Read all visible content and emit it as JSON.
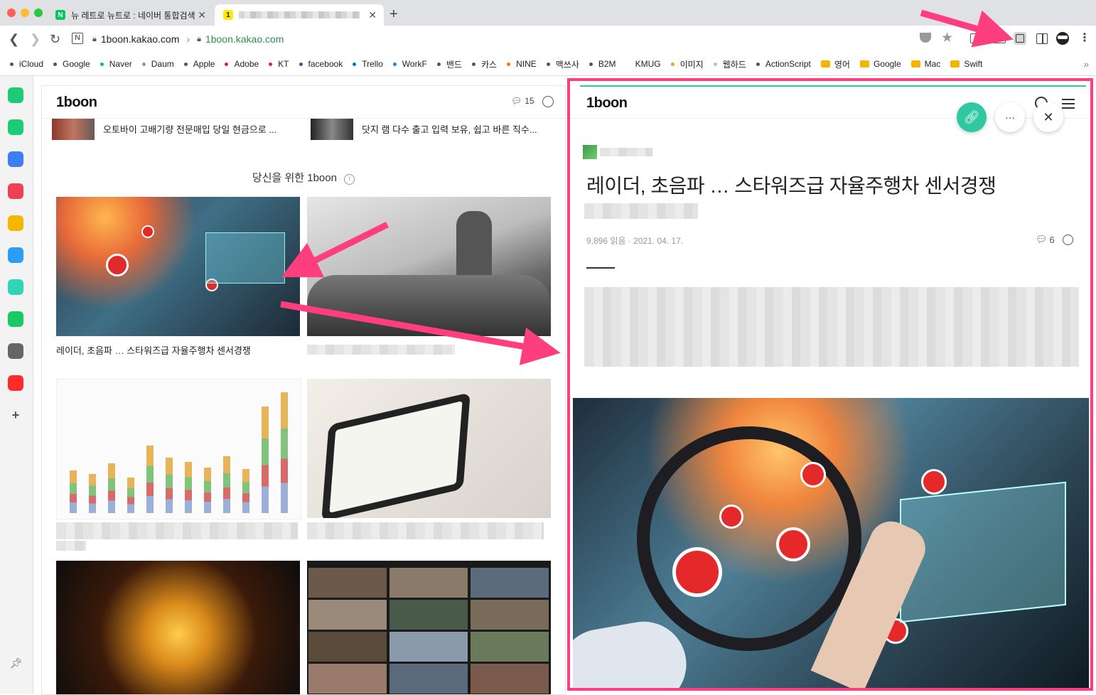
{
  "browser": {
    "tabs": [
      {
        "label": "뉴 레트로 뉴트로 : 네이버 통합검색",
        "favicon": "N",
        "favicon_color": "#03c75a"
      },
      {
        "label": "",
        "favicon": "1",
        "favicon_color": "#ffe812"
      }
    ],
    "url_host": "1boon.kakao.com",
    "url_full": "1boon.kakao.com"
  },
  "bookmarks": [
    {
      "label": "iCloud",
      "color": "#555"
    },
    {
      "label": "Google",
      "color": "#555"
    },
    {
      "label": "Naver",
      "color": "#03c75a"
    },
    {
      "label": "Daum",
      "color": "#7a9ad1"
    },
    {
      "label": "Apple",
      "color": "#555"
    },
    {
      "label": "Adobe",
      "color": "#e0242d"
    },
    {
      "label": "KT",
      "color": "#e0242d"
    },
    {
      "label": "facebook",
      "color": "#3b5998"
    },
    {
      "label": "Trello",
      "color": "#0079bf"
    },
    {
      "label": "WorkF",
      "color": "#1e88e5"
    },
    {
      "label": "밴드",
      "color": "#555"
    },
    {
      "label": "카스",
      "color": "#555"
    },
    {
      "label": "NINE",
      "color": "#ff6f00"
    },
    {
      "label": "맥쓰사",
      "color": "#555"
    },
    {
      "label": "B2M",
      "color": "#555"
    },
    {
      "label": "KMUG",
      "color": "#fff"
    },
    {
      "label": "이미지",
      "color": "#f4a21c"
    },
    {
      "label": "웹하드",
      "color": "#a9c1e3"
    },
    {
      "label": "ActionScript",
      "color": "#555"
    },
    {
      "label": "영어",
      "folder": true
    },
    {
      "label": "Google",
      "folder": true
    },
    {
      "label": "Mac",
      "folder": true
    },
    {
      "label": "Swift",
      "folder": true
    }
  ],
  "sidebar_icons": [
    {
      "name": "whale-circle-icon",
      "color": "#1ccb76"
    },
    {
      "name": "notification-icon",
      "color": "#1ccb76"
    },
    {
      "name": "briefcase-icon",
      "color": "#3d7ef5"
    },
    {
      "name": "pocket-icon",
      "color": "#ef4056"
    },
    {
      "name": "star-icon",
      "color": "#f7b500"
    },
    {
      "name": "translate-icon",
      "color": "#2c9cf5"
    },
    {
      "name": "play-icon",
      "color": "#2fd5b5"
    },
    {
      "name": "webtoon-icon",
      "color": "#18c964"
    },
    {
      "name": "memo-icon",
      "color": "#666"
    },
    {
      "name": "how-icon",
      "color": "#ff2b2b"
    },
    {
      "name": "add-icon",
      "color": "#555"
    }
  ],
  "left": {
    "logo": "1boon",
    "comment_count": "15",
    "top_items": [
      {
        "title": "오토바이 고배기량 전문매입 당일 현금으로 ..."
      },
      {
        "title": "닷지 램 다수 출고 입력 보유, 쉽고 바른 직수..."
      }
    ],
    "section_title": "당신을 위한 1boon",
    "info_glyph": "!",
    "cards": [
      {
        "title": "레이더, 초음파 … 스타워즈급 자율주행차 센서경쟁"
      }
    ]
  },
  "right": {
    "logo": "1boon",
    "headline": "레이더, 초음파 … 스타워즈급 자율주행차 센서경쟁",
    "meta": "9,896 읽음 · 2021. 04. 17.",
    "comment_count": "6",
    "more_glyph": "···"
  },
  "colors": {
    "accent": "#ff3e7f",
    "link_button": "#2fc8a0",
    "teal_line": "#2fc8a0"
  }
}
